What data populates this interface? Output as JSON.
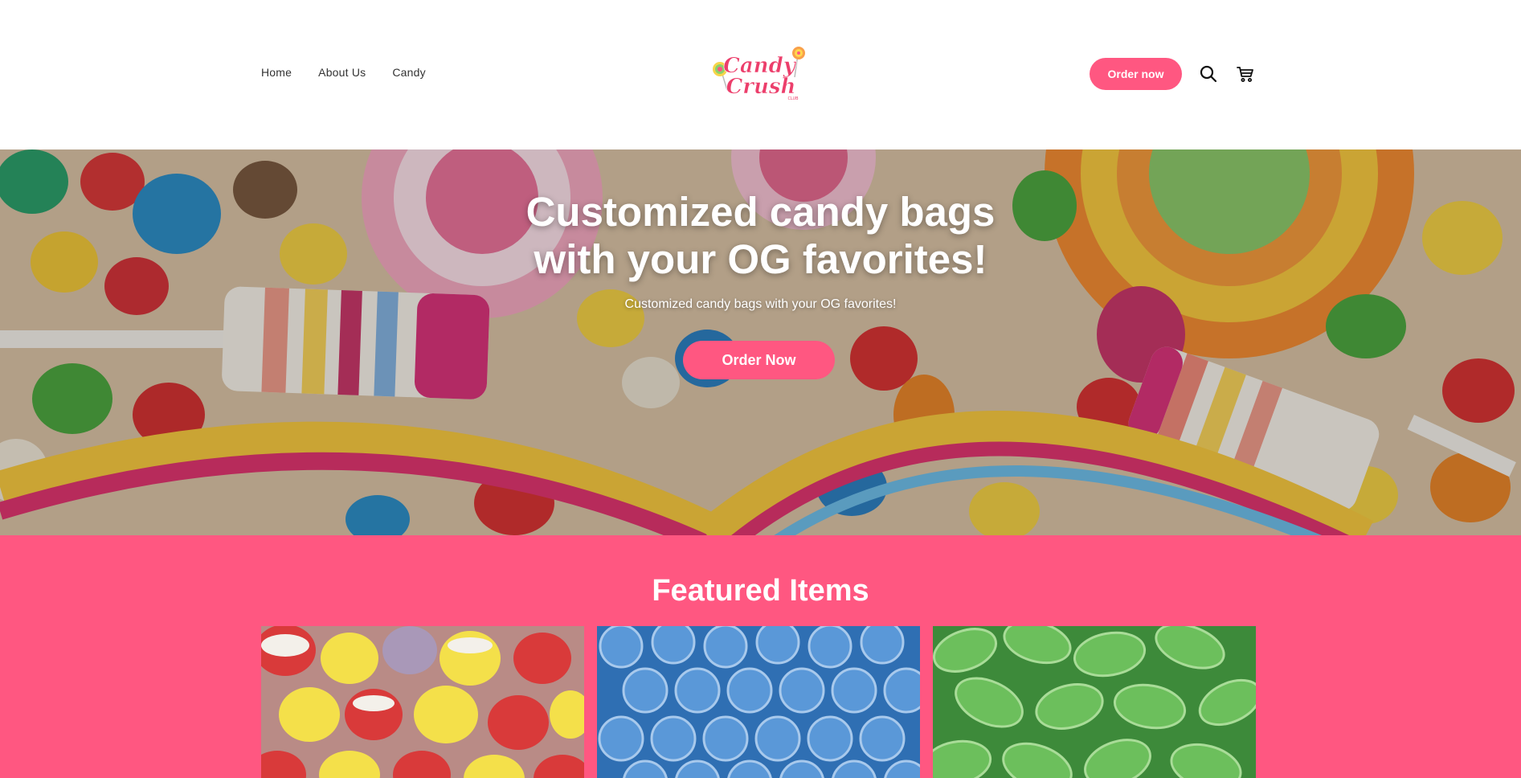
{
  "nav": {
    "items": [
      {
        "label": "Home"
      },
      {
        "label": "About Us"
      },
      {
        "label": "Candy"
      }
    ]
  },
  "logo": {
    "line1": "Candy",
    "line2": "Crush",
    "tag": "CLUB"
  },
  "header": {
    "order_label": "Order now",
    "icons": [
      "search-icon",
      "cart-icon"
    ]
  },
  "hero": {
    "title_line1": "Customized candy bags",
    "title_line2": "with your OG favorites!",
    "subtitle": "Customized candy bags with your OG favorites!",
    "button_label": "Order Now"
  },
  "featured": {
    "title": "Featured Items",
    "items": [
      {
        "image": "sour-gumdrops-image"
      },
      {
        "image": "blue-sour-candy-image"
      },
      {
        "image": "green-spearmint-leaves-image"
      }
    ]
  },
  "colors": {
    "accent": "#ff5781",
    "white": "#ffffff"
  }
}
